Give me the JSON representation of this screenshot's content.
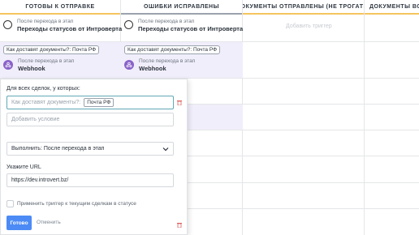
{
  "columns": [
    {
      "header": "ГОТОВЫ К ОТПРАВКЕ",
      "bar_color": "#f5c45e"
    },
    {
      "header": "ОШИБКИ ИСПРАВЛЕНЫ",
      "bar_color": "#9aa3ad"
    },
    {
      "header": "ДОКУМЕНТЫ ОТПРАВЛЕНЫ (НЕ ТРОГАТЬ)",
      "bar_color": "#f5c45e"
    },
    {
      "header": "ДОКУМЕНТЫ ВОЗВ",
      "bar_color": "#f5c45e"
    }
  ],
  "triggers": {
    "col1_status": {
      "small": "После перехода в этап",
      "main": "Переходы статусов от Интроверта"
    },
    "col2_status": {
      "small": "После перехода в этап",
      "main": "Переходы статусов от Интроверта"
    },
    "col1_condition": "Как доставят документы?: Почта РФ",
    "col2_condition": "Как доставят документы?: Почта РФ",
    "col1_webhook": {
      "small": "После перехода в этап",
      "main": "Webhook"
    },
    "col2_webhook": {
      "small": "После перехода в этап",
      "main": "Webhook"
    },
    "col3_ghost": "Добавить триггер"
  },
  "panel": {
    "for_all_label": "Для всех сделок, у которых:",
    "condition_field_label": "Как доставят документы?:",
    "condition_value": "Почта РФ",
    "add_condition_placeholder": "Добавить условие",
    "execute_value": "Выполнить: После перехода в этап",
    "url_label": "Укажите URL",
    "url_value": "https://dev.introvert.bz/",
    "apply_label": "Применить триггер к текущим сделкам в статусе",
    "done_label": "Готово",
    "cancel_label": "Отменить"
  },
  "colors": {
    "accent_blue": "#4c8bf5",
    "webhook_purple": "#8a63c9",
    "highlight_lilac": "#f1eefb",
    "active_border": "#60a7b5"
  }
}
